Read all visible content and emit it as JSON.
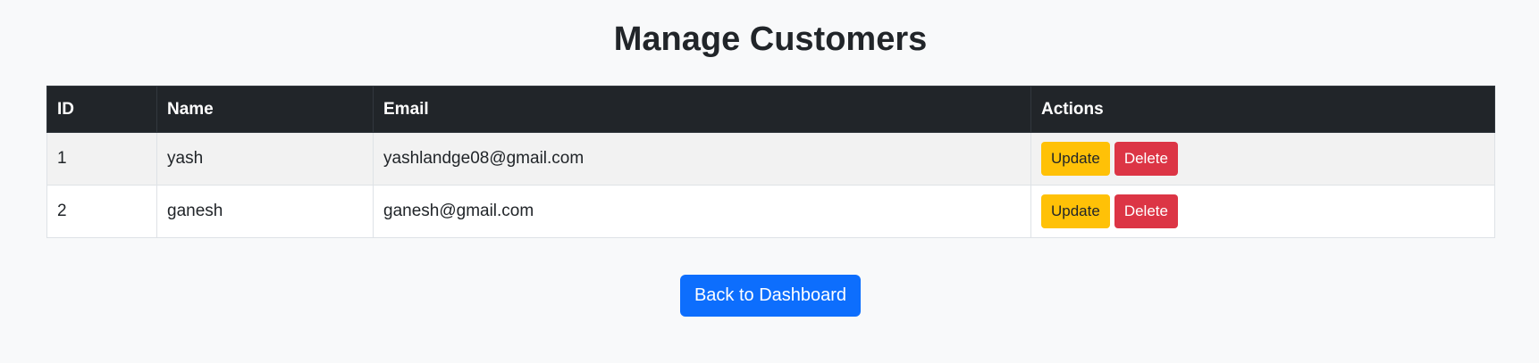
{
  "page": {
    "title": "Manage Customers"
  },
  "table": {
    "headers": [
      "ID",
      "Name",
      "Email",
      "Actions"
    ],
    "rows": [
      {
        "id": "1",
        "name": "yash",
        "email": "yashlandge08@gmail.com",
        "update_label": "Update",
        "delete_label": "Delete"
      },
      {
        "id": "2",
        "name": "ganesh",
        "email": "ganesh@gmail.com",
        "update_label": "Update",
        "delete_label": "Delete"
      }
    ]
  },
  "footer": {
    "back_label": "Back to Dashboard"
  },
  "colors": {
    "header_bg": "#212529",
    "update_button": "#ffc107",
    "delete_button": "#dc3545",
    "primary_button": "#0d6efd",
    "page_bg": "#f8f9fa"
  }
}
